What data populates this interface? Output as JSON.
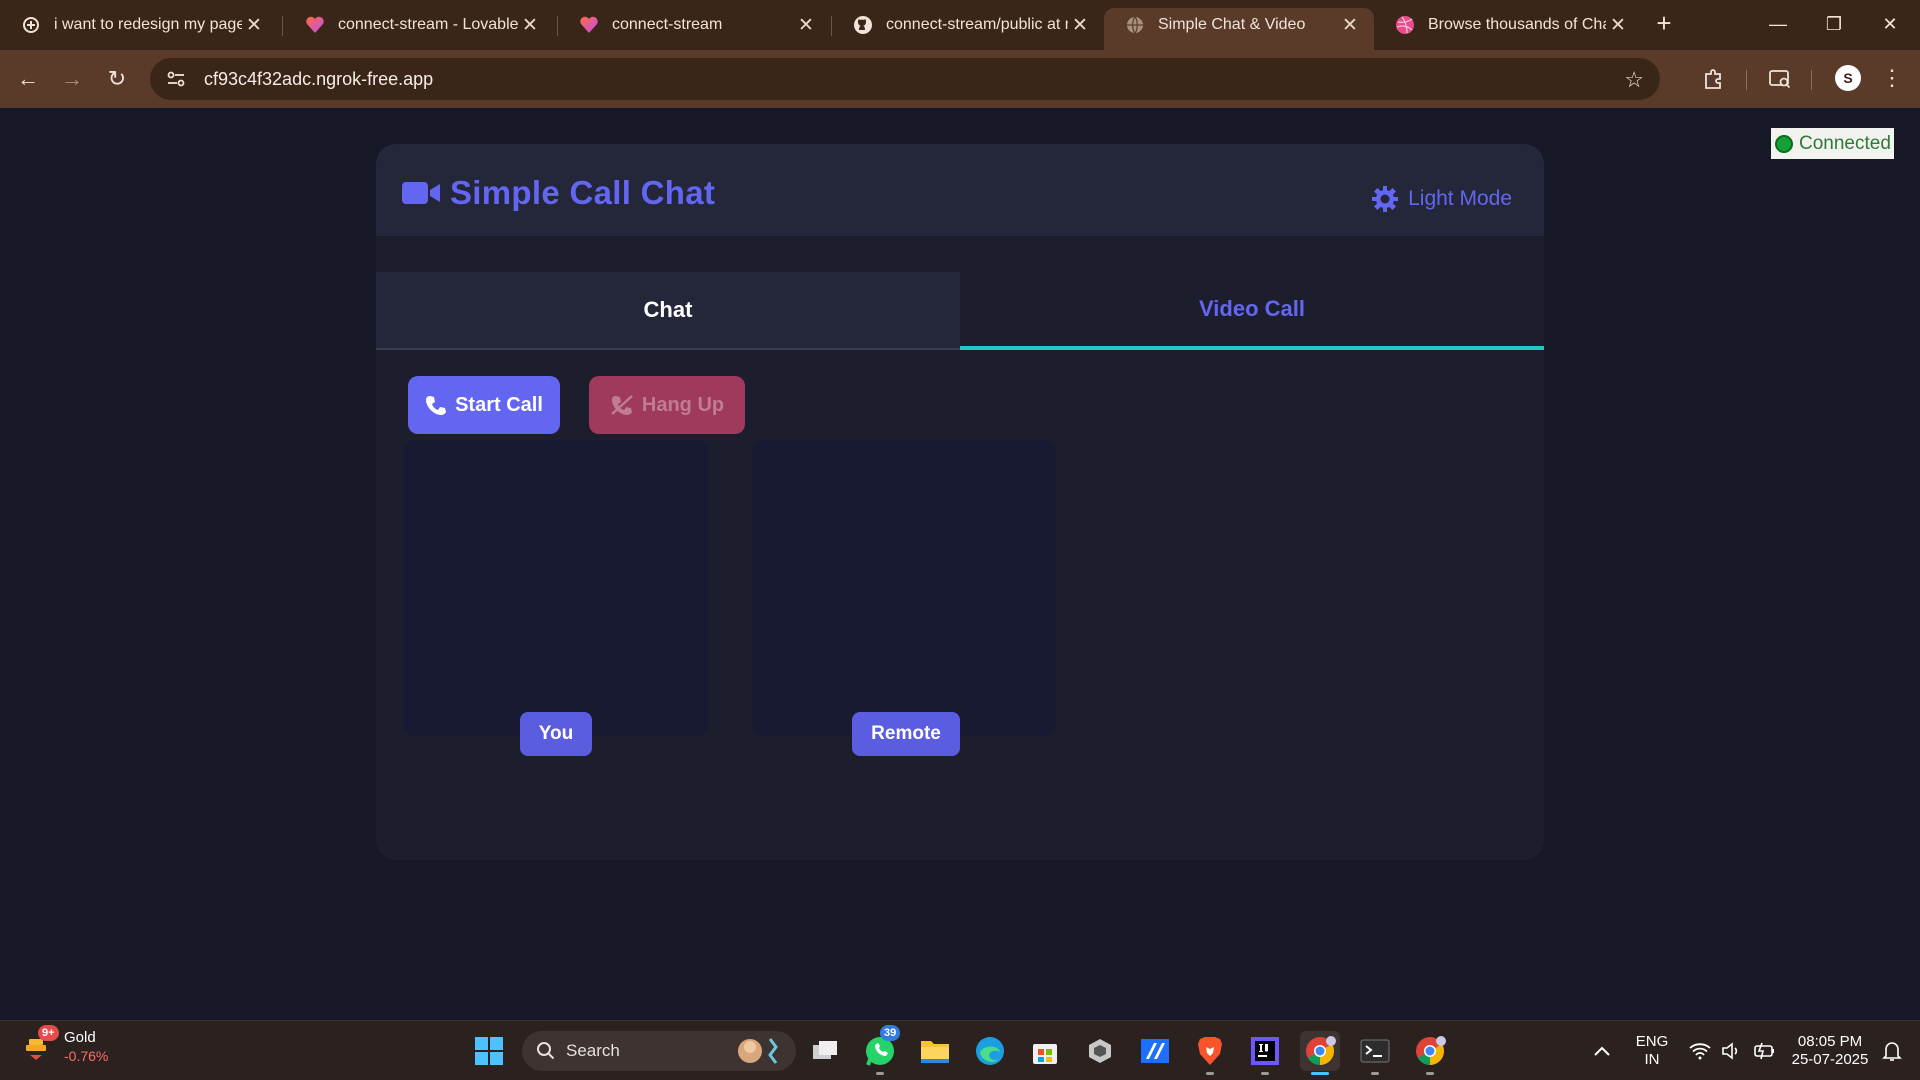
{
  "browser": {
    "tabs": [
      {
        "title": "i want to redesign my page",
        "icon": "openai-icon"
      },
      {
        "title": "connect-stream - Lovable",
        "icon": "lovable-icon"
      },
      {
        "title": "connect-stream",
        "icon": "lovable-icon"
      },
      {
        "title": "connect-stream/public at m",
        "icon": "github-icon"
      },
      {
        "title": "Simple Chat & Video",
        "icon": "globe-icon",
        "active": true
      },
      {
        "title": "Browse thousands of Chat /",
        "icon": "dribbble-icon"
      }
    ],
    "address": "cf93c4f32adc.ngrok-free.app",
    "profile_initial": "S"
  },
  "page": {
    "connection_status": "Connected",
    "app_title": "Simple Call Chat",
    "mode_toggle_label": "Light Mode",
    "tabs": {
      "chat": "Chat",
      "video": "Video Call"
    },
    "active_tab": "Video Call",
    "buttons": {
      "start_call": "Start Call",
      "hang_up": "Hang Up"
    },
    "videos": {
      "local_label": "You",
      "remote_label": "Remote"
    },
    "colors": {
      "accent": "#6366f1",
      "hangup": "#a03a5c",
      "status_green": "#15a035",
      "tab_underline": "#22c8c8"
    }
  },
  "taskbar": {
    "widget": {
      "name": "Gold",
      "change": "-0.76%",
      "badge": "9+"
    },
    "search_label": "Search",
    "whatsapp_badge": "39",
    "language": {
      "line1": "ENG",
      "line2": "IN"
    },
    "time": "08:05 PM",
    "date": "25-07-2025"
  }
}
